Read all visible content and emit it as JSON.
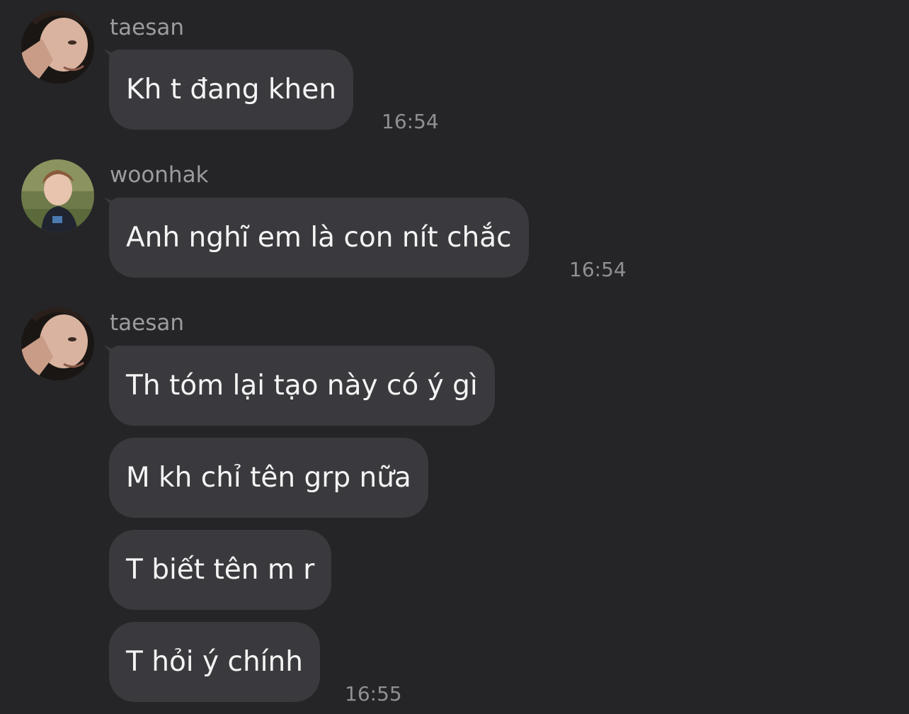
{
  "messages": [
    {
      "sender": "taesan",
      "avatar_icon": "profile-photo-taesan",
      "bubbles": [
        "Kh t đang khen"
      ],
      "time": "16:54"
    },
    {
      "sender": "woonhak",
      "avatar_icon": "profile-photo-woonhak",
      "bubbles": [
        "Anh nghĩ em là con nít chắc"
      ],
      "time": "16:54"
    },
    {
      "sender": "taesan",
      "avatar_icon": "profile-photo-taesan",
      "bubbles": [
        "Th tóm lại tạo này có ý gì",
        "M kh chỉ tên grp nữa",
        "T biết tên m r",
        "T hỏi ý chính"
      ],
      "time": "16:55"
    }
  ],
  "colors": {
    "background": "#252527",
    "bubble": "#3a3a3e",
    "text": "#f4f4f4",
    "sender": "#9c9ca0",
    "timestamp": "#909094"
  }
}
